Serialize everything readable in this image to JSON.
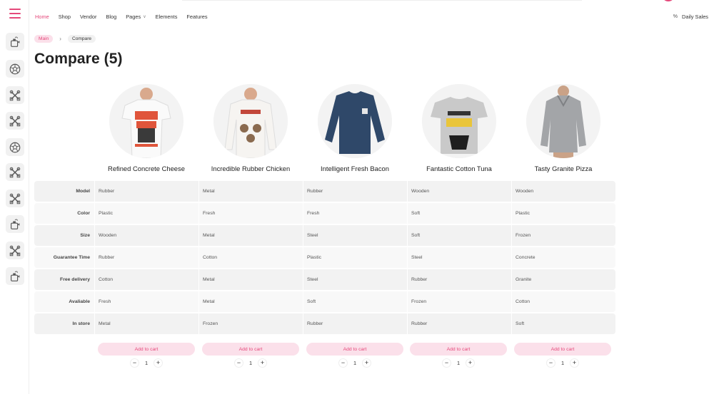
{
  "nav": {
    "items": [
      {
        "label": "Home",
        "active": true
      },
      {
        "label": "Shop"
      },
      {
        "label": "Vendor"
      },
      {
        "label": "Blog"
      },
      {
        "label": "Pages",
        "has_dropdown": true
      },
      {
        "label": "Elements"
      },
      {
        "label": "Features"
      }
    ],
    "daily_sales": {
      "icon": "percent-icon",
      "label": "Daily Sales"
    }
  },
  "sidebar": {
    "menu_icon": "hamburger-menu-icon",
    "buttons": [
      {
        "icon": "kettle-icon"
      },
      {
        "icon": "soccer-ball-icon"
      },
      {
        "icon": "crossed-tools-icon"
      },
      {
        "icon": "crossed-tools-icon"
      },
      {
        "icon": "soccer-ball-icon"
      },
      {
        "icon": "crossed-tools-icon"
      },
      {
        "icon": "crossed-tools-icon"
      },
      {
        "icon": "kettle-icon"
      },
      {
        "icon": "crossed-tools-icon"
      },
      {
        "icon": "kettle-icon"
      }
    ]
  },
  "breadcrumb": {
    "main": "Main",
    "current": "Compare"
  },
  "page_title": "Compare (5)",
  "products": [
    {
      "name": "Refined Concrete Cheese",
      "image": "white-tshirt-big-boy-print"
    },
    {
      "name": "Incredible Rubber Chicken",
      "image": "white-longsleeve-macarena-print"
    },
    {
      "name": "Intelligent Fresh Bacon",
      "image": "navy-longsleeve-tee"
    },
    {
      "name": "Fantastic Cotton Tuna",
      "image": "grey-batman-tee"
    },
    {
      "name": "Tasty Granite Pizza",
      "image": "grey-plaid-hoodie"
    }
  ],
  "table": {
    "rows": [
      {
        "label": "Model",
        "values": [
          "Rubber",
          "Metal",
          "Rubber",
          "Wooden",
          "Wooden"
        ]
      },
      {
        "label": "Color",
        "values": [
          "Plastic",
          "Fresh",
          "Fresh",
          "Soft",
          "Plastic"
        ]
      },
      {
        "label": "Size",
        "values": [
          "Wooden",
          "Metal",
          "Steel",
          "Soft",
          "Frozen"
        ]
      },
      {
        "label": "Guarantee Time",
        "values": [
          "Rubber",
          "Cotton",
          "Plastic",
          "Steel",
          "Concrete"
        ]
      },
      {
        "label": "Free delivery",
        "values": [
          "Cotton",
          "Metal",
          "Steel",
          "Rubber",
          "Granite"
        ]
      },
      {
        "label": "Avaliable",
        "values": [
          "Fresh",
          "Metal",
          "Soft",
          "Frozen",
          "Cotton"
        ]
      },
      {
        "label": "In store",
        "values": [
          "Metal",
          "Frozen",
          "Rubber",
          "Rubber",
          "Soft"
        ]
      }
    ]
  },
  "actions": {
    "add_to_cart_label": "Add to cart",
    "minus": "−",
    "plus": "+",
    "quantities": [
      "1",
      "1",
      "1",
      "1",
      "1"
    ]
  },
  "colors": {
    "accent": "#e5487a",
    "accent_light": "#fbe0ea"
  }
}
